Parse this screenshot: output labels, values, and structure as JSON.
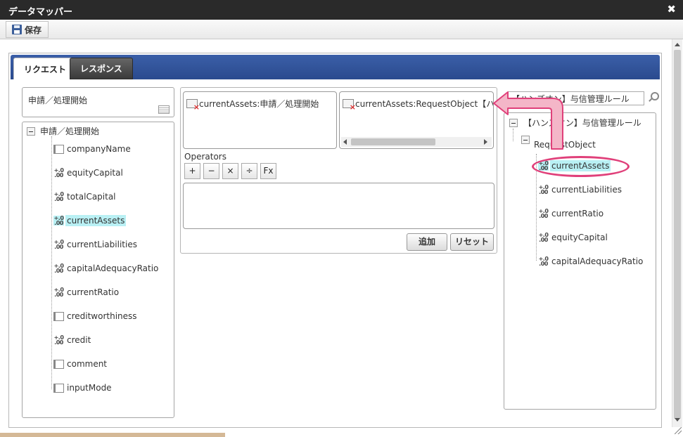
{
  "window": {
    "title": "データマッパー",
    "close_glyph": "✖"
  },
  "toolbar": {
    "save_label": "保存",
    "save_icon": "floppy-disk-icon"
  },
  "tabs": [
    {
      "label": "リクエスト",
      "active": true
    },
    {
      "label": "レスポンス",
      "active": false
    }
  ],
  "left": {
    "header": "申請／処理開始",
    "tree": {
      "root": "申請／処理開始",
      "items": [
        {
          "label": "companyName",
          "type": "field",
          "highlighted": false
        },
        {
          "label": "equityCapital",
          "type": "number",
          "highlighted": false
        },
        {
          "label": "totalCapital",
          "type": "number",
          "highlighted": false
        },
        {
          "label": "currentAssets",
          "type": "number",
          "highlighted": true
        },
        {
          "label": "currentLiabilities",
          "type": "number",
          "highlighted": false
        },
        {
          "label": "capitalAdequacyRatio",
          "type": "number",
          "highlighted": false
        },
        {
          "label": "currentRatio",
          "type": "number",
          "highlighted": false
        },
        {
          "label": "creditworthiness",
          "type": "field",
          "highlighted": false
        },
        {
          "label": "credit",
          "type": "number",
          "highlighted": false
        },
        {
          "label": "comment",
          "type": "field",
          "highlighted": false
        },
        {
          "label": "inputMode",
          "type": "field",
          "highlighted": false
        }
      ]
    }
  },
  "center": {
    "source_expr": "currentAssets:申請／処理開始",
    "target_expr": "currentAssets:RequestObject【ハンス",
    "operators_label": "Operators",
    "operators": [
      "+",
      "−",
      "×",
      "÷",
      "Fx"
    ],
    "formula_value": "",
    "add_label": "追加",
    "reset_label": "リセット"
  },
  "right": {
    "search_value": "【ハンズオン】与信管理ルール",
    "tree": {
      "root": "【ハンズオン】与信管理ルール",
      "object": "RequestObject",
      "items": [
        {
          "label": "currentAssets",
          "highlighted": true
        },
        {
          "label": "currentLiabilities",
          "highlighted": false
        },
        {
          "label": "currentRatio",
          "highlighted": false
        },
        {
          "label": "equityCapital",
          "highlighted": false
        },
        {
          "label": "capitalAdequacyRatio",
          "highlighted": false
        }
      ]
    }
  },
  "icons": {
    "number_glyph": "+.0\n.00",
    "annotation_color": "#e0407a",
    "arrow_fill": "#f4b6c8"
  }
}
